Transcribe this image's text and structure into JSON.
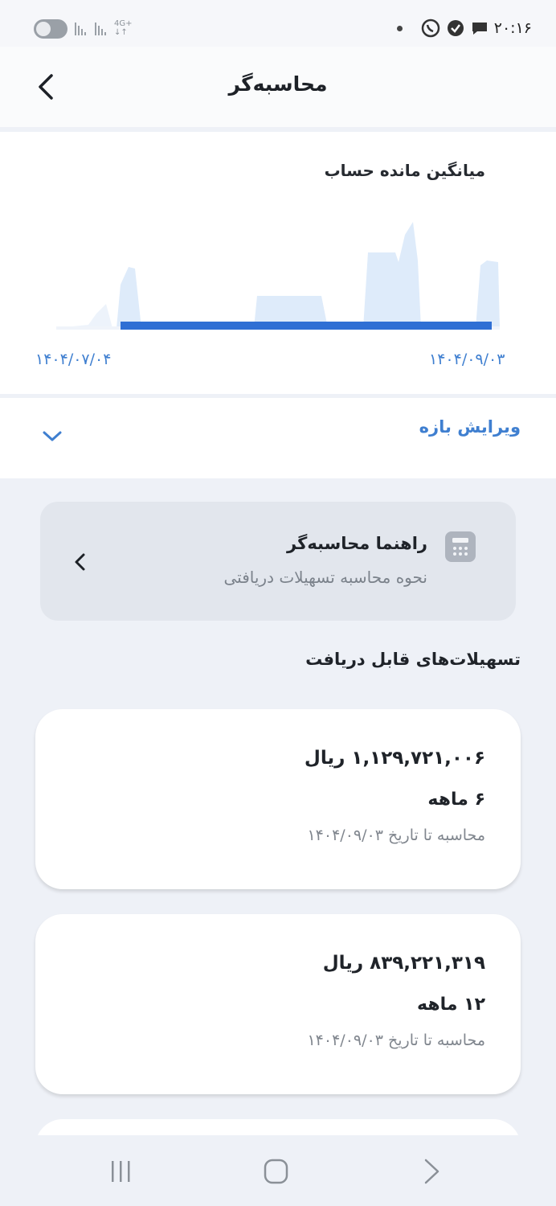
{
  "status_bar": {
    "time": "۲۰:۱۶",
    "network": "4G+",
    "icons": [
      "toggle-icon",
      "signal-icon",
      "whatsapp-icon",
      "check-badge-icon",
      "chat-icon"
    ]
  },
  "header": {
    "title": "محاسبه‌گر",
    "back_icon": "chevron-left-icon"
  },
  "chart": {
    "title": "میانگین مانده حساب",
    "start_date": "۱۴۰۴/۰۷/۰۴",
    "end_date": "۱۴۰۴/۰۹/۰۳"
  },
  "chart_data": {
    "type": "area",
    "x_range": [
      "۱۴۰۴/۰۷/۰۴",
      "۱۴۰۴/۰۹/۰۳"
    ],
    "grid": false,
    "legend": "none",
    "colors": {
      "area": "#deebfa",
      "selection": "#2f6fd4"
    }
  },
  "range": {
    "label": "ویرایش بازه",
    "icon": "chevron-down-icon"
  },
  "guide": {
    "title": "راهنما محاسبه‌گر",
    "subtitle": "نحوه محاسبه تسهیلات دریافتی",
    "icon": "calculator-icon"
  },
  "loans_section": {
    "title": "تسهیلات‌های قابل دریافت",
    "items": [
      {
        "amount": "۱,۱۲۹,۷۲۱,۰۰۶ ریال",
        "term": "۶ ماهه",
        "date": "محاسبه تا تاریخ ۱۴۰۴/۰۹/۰۳"
      },
      {
        "amount": "۸۳۹,۲۲۱,۳۱۹ ریال",
        "term": "۱۲ ماهه",
        "date": "محاسبه تا تاریخ ۱۴۰۴/۰۹/۰۳"
      }
    ]
  },
  "nav": {
    "icons": [
      "recent-apps-icon",
      "home-icon",
      "back-icon"
    ]
  },
  "colors": {
    "accent": "#3f7fd0",
    "background": "#eef1f7",
    "card": "#ffffff"
  }
}
